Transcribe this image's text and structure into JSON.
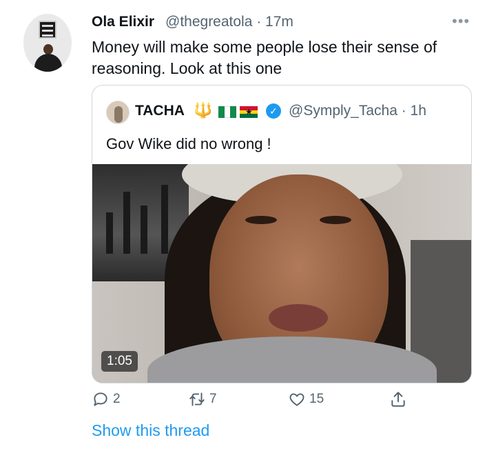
{
  "tweet": {
    "author_name": "Ola Elixir",
    "handle_time": "@thegreatola · 17m",
    "more_icon": "ellipsis-icon",
    "text": "Money will make some people lose their sense of reasoning. Look at this one"
  },
  "quoted_tweet": {
    "author_name": "TACHA",
    "emoji_trident": "🔱",
    "handle_time": "@Symply_Tacha · 1h",
    "text": "Gov Wike did no wrong !",
    "video_duration": "1:05"
  },
  "actions": {
    "reply_count": "2",
    "retweet_count": "7",
    "like_count": "15"
  },
  "thread_link": "Show this thread",
  "colors": {
    "accent": "#1d9bf0",
    "muted": "#536471",
    "border": "#cfd9de"
  }
}
